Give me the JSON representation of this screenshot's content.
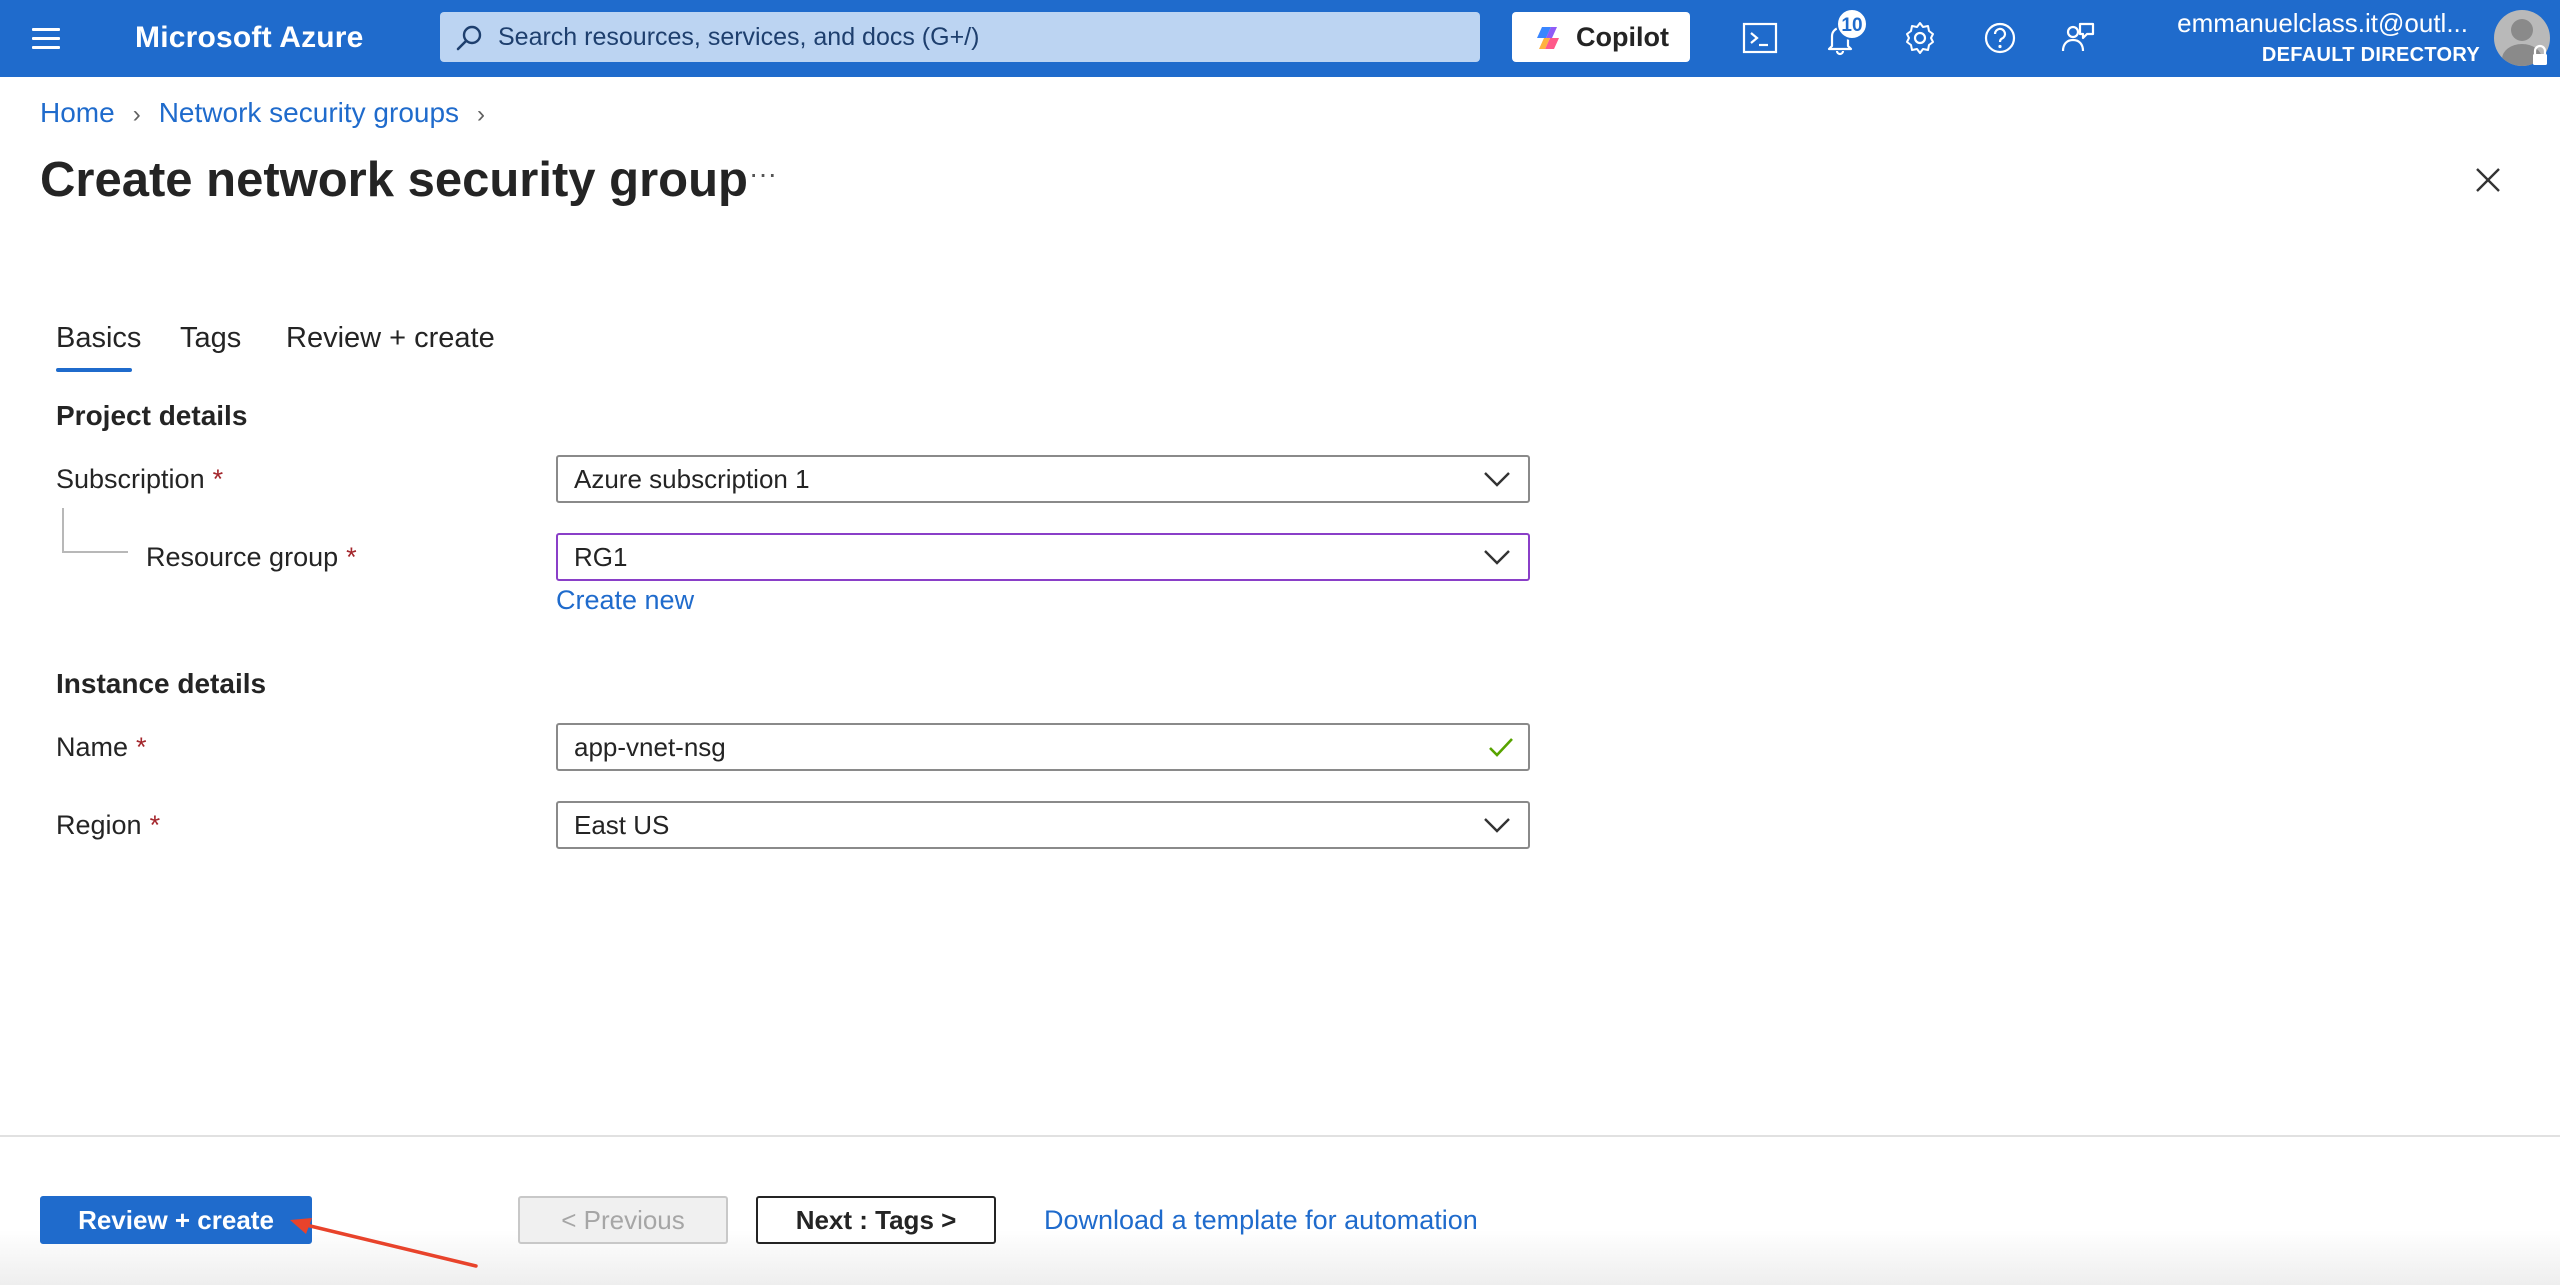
{
  "topbar": {
    "brand": "Microsoft Azure",
    "search_placeholder": "Search resources, services, and docs (G+/)",
    "copilot_label": "Copilot",
    "notification_count": "10",
    "account_email": "emmanuelclass.it@outl...",
    "account_directory": "DEFAULT DIRECTORY",
    "icons": [
      "hamburger-menu-icon",
      "search-icon",
      "copilot-icon",
      "cloud-shell-icon",
      "bell-icon",
      "gear-icon",
      "help-icon",
      "feedback-icon",
      "avatar-icon",
      "lock-icon"
    ]
  },
  "breadcrumb": {
    "items": [
      "Home",
      "Network security groups"
    ]
  },
  "page": {
    "title": "Create network security group",
    "more": "···"
  },
  "tabs": [
    {
      "label": "Basics",
      "active": true
    },
    {
      "label": "Tags",
      "active": false
    },
    {
      "label": "Review + create",
      "active": false
    }
  ],
  "form": {
    "project_details": "Project details",
    "subscription_label": "Subscription",
    "subscription_value": "Azure subscription 1",
    "resource_group_label": "Resource group",
    "resource_group_value": "RG1",
    "create_new": "Create new",
    "instance_details": "Instance details",
    "name_label": "Name",
    "name_value": "app-vnet-nsg",
    "region_label": "Region",
    "region_value": "East US",
    "required_mark": "*"
  },
  "footer": {
    "review_create": "Review + create",
    "previous": "< Previous",
    "next": "Next : Tags >",
    "download": "Download a template for automation"
  },
  "colors": {
    "azure_blue": "#1f6bcc",
    "focus_purple": "#8a3fc8",
    "required_red": "#a4262c",
    "valid_green": "#57a300",
    "annotation_red": "#e8432b"
  }
}
